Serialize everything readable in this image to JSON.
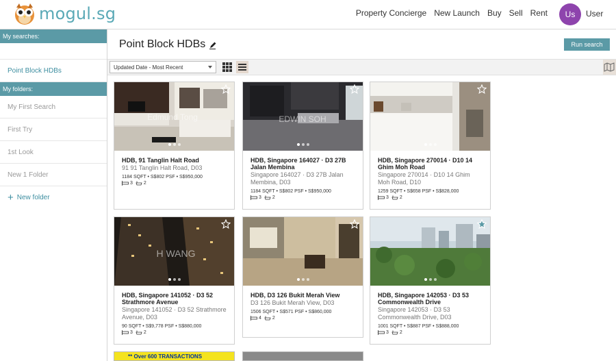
{
  "header": {
    "logo_text": "mogul.sg",
    "nav": [
      "Property Concierge",
      "New Launch",
      "Buy",
      "Sell",
      "Rent"
    ],
    "avatar_initials": "Us",
    "user_label": "User"
  },
  "sidebar": {
    "my_searches_label": "My searches:",
    "active_search": "Point Block HDBs",
    "my_folders_label": "My folders:",
    "folders": [
      "My First Search",
      "First Try",
      "1st Look",
      "New 1 Folder"
    ],
    "new_folder_label": "New folder"
  },
  "main": {
    "title": "Point Block HDBs",
    "run_search_label": "Run search",
    "sort_value": "Updated Date - Most Recent"
  },
  "listings": [
    {
      "title": "HDB, 91 Tanglin Halt Road",
      "address": "91 91 Tanglin Halt Road, D03",
      "specs": "1184 SQFT • S$802 PSF • S$950,000",
      "beds": "3",
      "baths": "2",
      "watermark": "Edmund Tong"
    },
    {
      "title": "HDB, Singapore 164027 · D3 27B Jalan Membina",
      "address": "Singapore 164027 · D3 27B Jalan Membina, D03",
      "specs": "1184 SQFT • S$802 PSF • S$950,000",
      "beds": "3",
      "baths": "2",
      "watermark": "EDWIN SOH"
    },
    {
      "title": "HDB, Singapore 270014 · D10 14 Ghim Moh Road",
      "address": "Singapore 270014 · D10 14 Ghim Moh Road, D10",
      "specs": "1259 SQFT • S$658 PSF • S$828,000",
      "beds": "3",
      "baths": "2",
      "watermark": ""
    },
    {
      "title": "HDB, Singapore 141052 · D3 52 Strathmore Avenue",
      "address": "Singapore 141052 · D3 52 Strathmore Avenue, D03",
      "specs": "90 SQFT • S$9,778 PSF • S$880,000",
      "beds": "3",
      "baths": "2",
      "watermark": "H WANG"
    },
    {
      "title": "HDB, D3 126 Bukit Merah View",
      "address": "D3 126 Bukit Merah View, D03",
      "specs": "1506 SQFT • S$571 PSF • S$860,000",
      "beds": "4",
      "baths": "2",
      "watermark": ""
    },
    {
      "title": "HDB, Singapore 142053 · D3 53 Commonwealth Drive",
      "address": "Singapore 142053 · D3 53 Commonwealth Drive, D03",
      "specs": "1001 SQFT • S$887 PSF • S$888,000",
      "beds": "3",
      "baths": "2",
      "watermark": ""
    }
  ],
  "banner_text": "** Over 600 TRANSACTIONS",
  "colors": {
    "accent": "#5b9aa6",
    "link": "#3d8ea0",
    "avatar": "#8e44ad"
  }
}
